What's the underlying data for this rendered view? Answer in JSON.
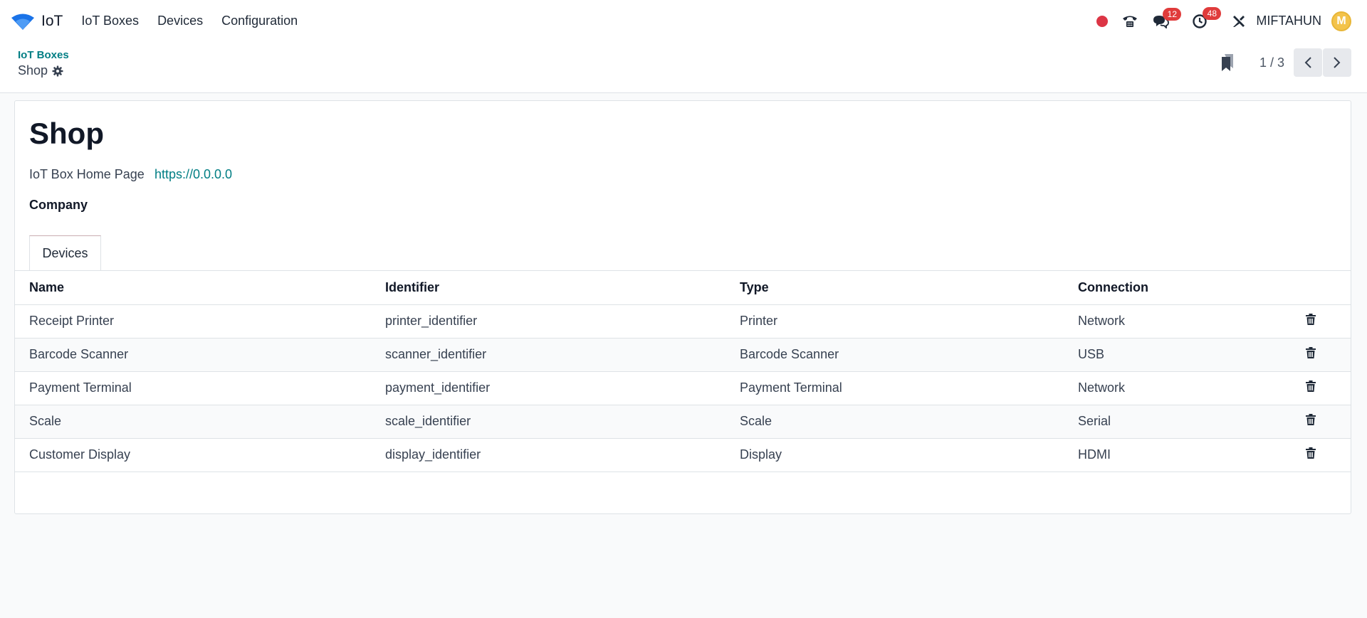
{
  "navbar": {
    "app_name": "IoT",
    "menu": [
      "IoT Boxes",
      "Devices",
      "Configuration"
    ],
    "messages_count": "12",
    "activities_count": "48",
    "username": "MIFTAHUN",
    "avatar_letter": "M",
    "brand_color": "#1a73e8"
  },
  "control_panel": {
    "breadcrumb": "IoT Boxes",
    "record_name": "Shop",
    "pager": "1 / 3"
  },
  "form": {
    "title": "Shop",
    "home_page_label": "IoT Box Home Page",
    "home_page_value": "https://0.0.0.0",
    "company_label": "Company",
    "tab_label": "Devices"
  },
  "table": {
    "headers": [
      "Name",
      "Identifier",
      "Type",
      "Connection"
    ],
    "rows": [
      [
        "Receipt Printer",
        "printer_identifier",
        "Printer",
        "Network"
      ],
      [
        "Barcode Scanner",
        "scanner_identifier",
        "Barcode Scanner",
        "USB"
      ],
      [
        "Payment Terminal",
        "payment_identifier",
        "Payment Terminal",
        "Network"
      ],
      [
        "Scale",
        "scale_identifier",
        "Scale",
        "Serial"
      ],
      [
        "Customer Display",
        "display_identifier",
        "Display",
        "HDMI"
      ]
    ]
  },
  "colors": {
    "accent": "#017e84",
    "badge": "#e03b3b",
    "recording": "#dc3545"
  }
}
